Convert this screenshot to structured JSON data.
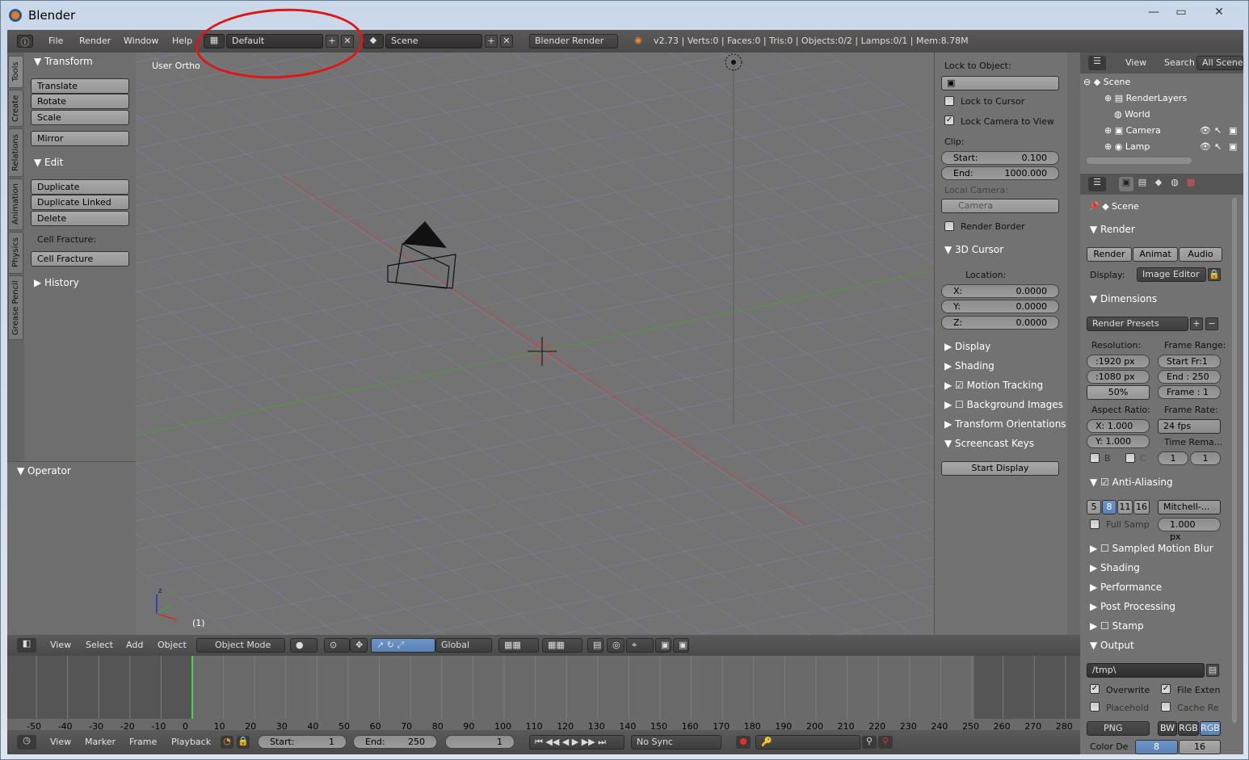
{
  "window": {
    "title": "Blender",
    "minimize": "—",
    "maximize": "▭",
    "close": "✕"
  },
  "info": {
    "menus": [
      "File",
      "Render",
      "Window",
      "Help"
    ],
    "layout": "Default",
    "scene": "Scene",
    "engine": "Blender Render",
    "stats": "v2.73 | Verts:0 | Faces:0 | Tris:0 | Objects:0/2 | Lamps:0/1 | Mem:8.78M"
  },
  "toolshelf": {
    "tabs": [
      "Tools",
      "Create",
      "Relations",
      "Animation",
      "Physics",
      "Grease Pencil"
    ],
    "transform": {
      "title": "Transform",
      "buttons": [
        "Translate",
        "Rotate",
        "Scale",
        "Mirror"
      ]
    },
    "edit": {
      "title": "Edit",
      "buttons": [
        "Duplicate",
        "Duplicate Linked",
        "Delete"
      ],
      "cell_label": "Cell Fracture:",
      "cell_button": "Cell Fracture"
    },
    "history": "History",
    "operator": "Operator"
  },
  "viewport": {
    "label": "User Ortho",
    "frame": "(1)"
  },
  "npanel": {
    "lock_to_object": "Lock to Object:",
    "lock_cursor": "Lock to Cursor",
    "lock_camera": "Lock Camera to View",
    "clip": "Clip:",
    "start_label": "Start:",
    "start_val": "0.100",
    "end_label": "End:",
    "end_val": "1000.000",
    "local_camera": "Local Camera:",
    "camera": "Camera",
    "render_border": "Render Border",
    "cursor_title": "3D Cursor",
    "location": "Location:",
    "x_label": "X:",
    "x_val": "0.0000",
    "y_label": "Y:",
    "y_val": "0.0000",
    "z_label": "Z:",
    "z_val": "0.0000",
    "display": "Display",
    "shading": "Shading",
    "motion": "Motion Tracking",
    "background": "Background Images",
    "orientations": "Transform Orientations",
    "screencast": "Screencast Keys",
    "start_display": "Start Display"
  },
  "outliner": {
    "view": "View",
    "search": "Search",
    "all": "All Scenes",
    "items": [
      "Scene",
      "RenderLayers",
      "World",
      "Camera",
      "Lamp"
    ]
  },
  "props": {
    "scene": "Scene",
    "render_title": "Render",
    "render_btn": "Render",
    "anim_btn": "Animat",
    "audio_btn": "Audio",
    "display_label": "Display:",
    "display_val": "Image Editor",
    "dimensions": "Dimensions",
    "presets": "Render Presets",
    "resolution": "Resolution:",
    "frame_range": "Frame Range:",
    "resx": ":1920 px",
    "resy": ":1080 px",
    "pct": "50%",
    "start_fr": "Start Fr:1",
    "end_fr": "End : 250",
    "frame": "Frame : 1",
    "aspect": "Aspect Ratio:",
    "frame_rate": "Frame Rate:",
    "ax": "X:  1.000",
    "ay": "Y:  1.000",
    "fps": "24 fps",
    "time_rem": "Time Rema...",
    "b": "B",
    "c": "C",
    "t1": "1",
    "t2": "1",
    "aa": "Anti-Aliasing",
    "aa_vals": [
      "5",
      "8",
      "11",
      "16"
    ],
    "filter": "Mitchell-...",
    "full_samp": "Full Samp",
    "px": "1.000 px",
    "smb": "Sampled Motion Blur",
    "shading": "Shading",
    "performance": "Performance",
    "post": "Post Processing",
    "stamp": "Stamp",
    "output": "Output",
    "path": "/tmp\\",
    "overwrite": "Overwrite",
    "file_ext": "File Exten",
    "placeholder": "Placehold",
    "cache": "Cache Re",
    "format": "PNG",
    "bw": "BW",
    "rgb": "RGB",
    "rgba": "RGB",
    "color_depth": "Color De",
    "d8": "8",
    "d16": "16"
  },
  "view3d_header": {
    "menus": [
      "View",
      "Select",
      "Add",
      "Object"
    ],
    "mode": "Object Mode",
    "orientation": "Global"
  },
  "timeline": {
    "ticks": [
      "-50",
      "-40",
      "-30",
      "-20",
      "-10",
      "0",
      "10",
      "20",
      "30",
      "40",
      "50",
      "60",
      "70",
      "80",
      "90",
      "100",
      "110",
      "120",
      "130",
      "140",
      "150",
      "160",
      "170",
      "180",
      "190",
      "200",
      "210",
      "220",
      "230",
      "240",
      "250",
      "260",
      "270",
      "280"
    ],
    "menus": [
      "View",
      "Marker",
      "Frame",
      "Playback"
    ],
    "start_label": "Start:",
    "start_val": "1",
    "end_label": "End:",
    "end_val": "250",
    "current": "1",
    "sync": "No Sync"
  }
}
